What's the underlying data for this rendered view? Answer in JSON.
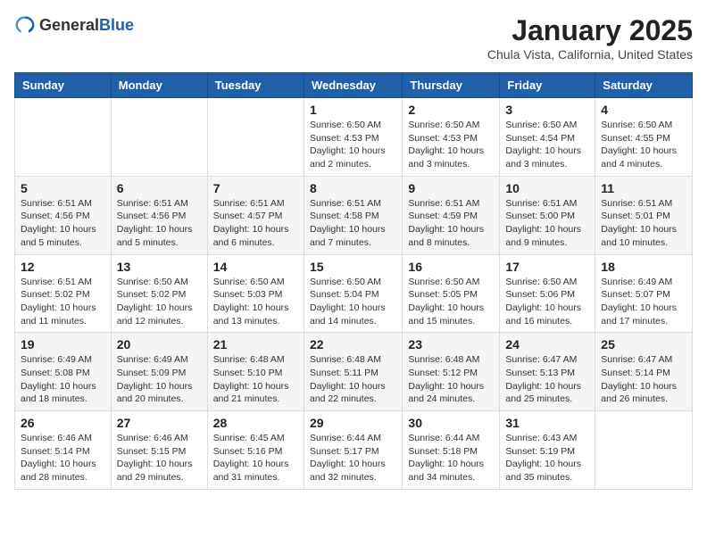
{
  "header": {
    "logo_general": "General",
    "logo_blue": "Blue",
    "month": "January 2025",
    "location": "Chula Vista, California, United States"
  },
  "weekdays": [
    "Sunday",
    "Monday",
    "Tuesday",
    "Wednesday",
    "Thursday",
    "Friday",
    "Saturday"
  ],
  "weeks": [
    [
      {
        "day": "",
        "info": ""
      },
      {
        "day": "",
        "info": ""
      },
      {
        "day": "",
        "info": ""
      },
      {
        "day": "1",
        "info": "Sunrise: 6:50 AM\nSunset: 4:53 PM\nDaylight: 10 hours\nand 2 minutes."
      },
      {
        "day": "2",
        "info": "Sunrise: 6:50 AM\nSunset: 4:53 PM\nDaylight: 10 hours\nand 3 minutes."
      },
      {
        "day": "3",
        "info": "Sunrise: 6:50 AM\nSunset: 4:54 PM\nDaylight: 10 hours\nand 3 minutes."
      },
      {
        "day": "4",
        "info": "Sunrise: 6:50 AM\nSunset: 4:55 PM\nDaylight: 10 hours\nand 4 minutes."
      }
    ],
    [
      {
        "day": "5",
        "info": "Sunrise: 6:51 AM\nSunset: 4:56 PM\nDaylight: 10 hours\nand 5 minutes."
      },
      {
        "day": "6",
        "info": "Sunrise: 6:51 AM\nSunset: 4:56 PM\nDaylight: 10 hours\nand 5 minutes."
      },
      {
        "day": "7",
        "info": "Sunrise: 6:51 AM\nSunset: 4:57 PM\nDaylight: 10 hours\nand 6 minutes."
      },
      {
        "day": "8",
        "info": "Sunrise: 6:51 AM\nSunset: 4:58 PM\nDaylight: 10 hours\nand 7 minutes."
      },
      {
        "day": "9",
        "info": "Sunrise: 6:51 AM\nSunset: 4:59 PM\nDaylight: 10 hours\nand 8 minutes."
      },
      {
        "day": "10",
        "info": "Sunrise: 6:51 AM\nSunset: 5:00 PM\nDaylight: 10 hours\nand 9 minutes."
      },
      {
        "day": "11",
        "info": "Sunrise: 6:51 AM\nSunset: 5:01 PM\nDaylight: 10 hours\nand 10 minutes."
      }
    ],
    [
      {
        "day": "12",
        "info": "Sunrise: 6:51 AM\nSunset: 5:02 PM\nDaylight: 10 hours\nand 11 minutes."
      },
      {
        "day": "13",
        "info": "Sunrise: 6:50 AM\nSunset: 5:02 PM\nDaylight: 10 hours\nand 12 minutes."
      },
      {
        "day": "14",
        "info": "Sunrise: 6:50 AM\nSunset: 5:03 PM\nDaylight: 10 hours\nand 13 minutes."
      },
      {
        "day": "15",
        "info": "Sunrise: 6:50 AM\nSunset: 5:04 PM\nDaylight: 10 hours\nand 14 minutes."
      },
      {
        "day": "16",
        "info": "Sunrise: 6:50 AM\nSunset: 5:05 PM\nDaylight: 10 hours\nand 15 minutes."
      },
      {
        "day": "17",
        "info": "Sunrise: 6:50 AM\nSunset: 5:06 PM\nDaylight: 10 hours\nand 16 minutes."
      },
      {
        "day": "18",
        "info": "Sunrise: 6:49 AM\nSunset: 5:07 PM\nDaylight: 10 hours\nand 17 minutes."
      }
    ],
    [
      {
        "day": "19",
        "info": "Sunrise: 6:49 AM\nSunset: 5:08 PM\nDaylight: 10 hours\nand 18 minutes."
      },
      {
        "day": "20",
        "info": "Sunrise: 6:49 AM\nSunset: 5:09 PM\nDaylight: 10 hours\nand 20 minutes."
      },
      {
        "day": "21",
        "info": "Sunrise: 6:48 AM\nSunset: 5:10 PM\nDaylight: 10 hours\nand 21 minutes."
      },
      {
        "day": "22",
        "info": "Sunrise: 6:48 AM\nSunset: 5:11 PM\nDaylight: 10 hours\nand 22 minutes."
      },
      {
        "day": "23",
        "info": "Sunrise: 6:48 AM\nSunset: 5:12 PM\nDaylight: 10 hours\nand 24 minutes."
      },
      {
        "day": "24",
        "info": "Sunrise: 6:47 AM\nSunset: 5:13 PM\nDaylight: 10 hours\nand 25 minutes."
      },
      {
        "day": "25",
        "info": "Sunrise: 6:47 AM\nSunset: 5:14 PM\nDaylight: 10 hours\nand 26 minutes."
      }
    ],
    [
      {
        "day": "26",
        "info": "Sunrise: 6:46 AM\nSunset: 5:14 PM\nDaylight: 10 hours\nand 28 minutes."
      },
      {
        "day": "27",
        "info": "Sunrise: 6:46 AM\nSunset: 5:15 PM\nDaylight: 10 hours\nand 29 minutes."
      },
      {
        "day": "28",
        "info": "Sunrise: 6:45 AM\nSunset: 5:16 PM\nDaylight: 10 hours\nand 31 minutes."
      },
      {
        "day": "29",
        "info": "Sunrise: 6:44 AM\nSunset: 5:17 PM\nDaylight: 10 hours\nand 32 minutes."
      },
      {
        "day": "30",
        "info": "Sunrise: 6:44 AM\nSunset: 5:18 PM\nDaylight: 10 hours\nand 34 minutes."
      },
      {
        "day": "31",
        "info": "Sunrise: 6:43 AM\nSunset: 5:19 PM\nDaylight: 10 hours\nand 35 minutes."
      },
      {
        "day": "",
        "info": ""
      }
    ]
  ]
}
